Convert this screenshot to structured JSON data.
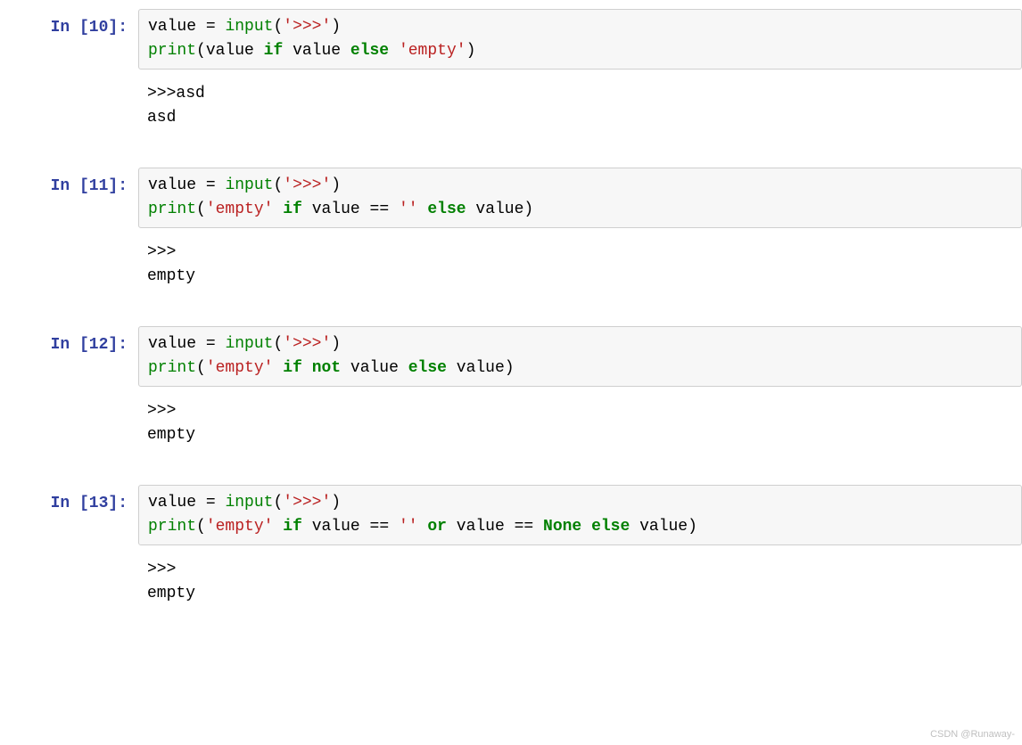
{
  "cells": [
    {
      "prompt": "In [10]:",
      "code_tokens": [
        {
          "t": "value",
          "c": "tok-name"
        },
        {
          "t": " ",
          "c": "tok-punc"
        },
        {
          "t": "=",
          "c": "tok-op"
        },
        {
          "t": " ",
          "c": "tok-punc"
        },
        {
          "t": "input",
          "c": "tok-builtin"
        },
        {
          "t": "(",
          "c": "tok-punc"
        },
        {
          "t": "'>>>'",
          "c": "tok-string"
        },
        {
          "t": ")",
          "c": "tok-punc"
        },
        {
          "t": "\n",
          "c": "tok-punc"
        },
        {
          "t": "print",
          "c": "tok-builtin"
        },
        {
          "t": "(",
          "c": "tok-punc"
        },
        {
          "t": "value",
          "c": "tok-name"
        },
        {
          "t": " ",
          "c": "tok-punc"
        },
        {
          "t": "if",
          "c": "tok-keyword"
        },
        {
          "t": " ",
          "c": "tok-punc"
        },
        {
          "t": "value",
          "c": "tok-name"
        },
        {
          "t": " ",
          "c": "tok-punc"
        },
        {
          "t": "else",
          "c": "tok-keyword"
        },
        {
          "t": " ",
          "c": "tok-punc"
        },
        {
          "t": "'empty'",
          "c": "tok-string"
        },
        {
          "t": ")",
          "c": "tok-punc"
        }
      ],
      "output": ">>>asd\nasd"
    },
    {
      "prompt": "In [11]:",
      "code_tokens": [
        {
          "t": "value",
          "c": "tok-name"
        },
        {
          "t": " ",
          "c": "tok-punc"
        },
        {
          "t": "=",
          "c": "tok-op"
        },
        {
          "t": " ",
          "c": "tok-punc"
        },
        {
          "t": "input",
          "c": "tok-builtin"
        },
        {
          "t": "(",
          "c": "tok-punc"
        },
        {
          "t": "'>>>'",
          "c": "tok-string"
        },
        {
          "t": ")",
          "c": "tok-punc"
        },
        {
          "t": "\n",
          "c": "tok-punc"
        },
        {
          "t": "print",
          "c": "tok-builtin"
        },
        {
          "t": "(",
          "c": "tok-punc"
        },
        {
          "t": "'empty'",
          "c": "tok-string"
        },
        {
          "t": " ",
          "c": "tok-punc"
        },
        {
          "t": "if",
          "c": "tok-keyword"
        },
        {
          "t": " ",
          "c": "tok-punc"
        },
        {
          "t": "value",
          "c": "tok-name"
        },
        {
          "t": " ",
          "c": "tok-punc"
        },
        {
          "t": "==",
          "c": "tok-op"
        },
        {
          "t": " ",
          "c": "tok-punc"
        },
        {
          "t": "''",
          "c": "tok-string"
        },
        {
          "t": " ",
          "c": "tok-punc"
        },
        {
          "t": "else",
          "c": "tok-keyword"
        },
        {
          "t": " ",
          "c": "tok-punc"
        },
        {
          "t": "value",
          "c": "tok-name"
        },
        {
          "t": ")",
          "c": "tok-punc"
        }
      ],
      "output": ">>>\nempty"
    },
    {
      "prompt": "In [12]:",
      "code_tokens": [
        {
          "t": "value",
          "c": "tok-name"
        },
        {
          "t": " ",
          "c": "tok-punc"
        },
        {
          "t": "=",
          "c": "tok-op"
        },
        {
          "t": " ",
          "c": "tok-punc"
        },
        {
          "t": "input",
          "c": "tok-builtin"
        },
        {
          "t": "(",
          "c": "tok-punc"
        },
        {
          "t": "'>>>'",
          "c": "tok-string"
        },
        {
          "t": ")",
          "c": "tok-punc"
        },
        {
          "t": "\n",
          "c": "tok-punc"
        },
        {
          "t": "print",
          "c": "tok-builtin"
        },
        {
          "t": "(",
          "c": "tok-punc"
        },
        {
          "t": "'empty'",
          "c": "tok-string"
        },
        {
          "t": " ",
          "c": "tok-punc"
        },
        {
          "t": "if",
          "c": "tok-keyword"
        },
        {
          "t": " ",
          "c": "tok-punc"
        },
        {
          "t": "not",
          "c": "tok-keyword"
        },
        {
          "t": " ",
          "c": "tok-punc"
        },
        {
          "t": "value",
          "c": "tok-name"
        },
        {
          "t": " ",
          "c": "tok-punc"
        },
        {
          "t": "else",
          "c": "tok-keyword"
        },
        {
          "t": " ",
          "c": "tok-punc"
        },
        {
          "t": "value",
          "c": "tok-name"
        },
        {
          "t": ")",
          "c": "tok-punc"
        }
      ],
      "output": ">>>\nempty"
    },
    {
      "prompt": "In [13]:",
      "code_tokens": [
        {
          "t": "value",
          "c": "tok-name"
        },
        {
          "t": " ",
          "c": "tok-punc"
        },
        {
          "t": "=",
          "c": "tok-op"
        },
        {
          "t": " ",
          "c": "tok-punc"
        },
        {
          "t": "input",
          "c": "tok-builtin"
        },
        {
          "t": "(",
          "c": "tok-punc"
        },
        {
          "t": "'>>>'",
          "c": "tok-string"
        },
        {
          "t": ")",
          "c": "tok-punc"
        },
        {
          "t": "\n",
          "c": "tok-punc"
        },
        {
          "t": "print",
          "c": "tok-builtin"
        },
        {
          "t": "(",
          "c": "tok-punc"
        },
        {
          "t": "'empty'",
          "c": "tok-string"
        },
        {
          "t": " ",
          "c": "tok-punc"
        },
        {
          "t": "if",
          "c": "tok-keyword"
        },
        {
          "t": " ",
          "c": "tok-punc"
        },
        {
          "t": "value",
          "c": "tok-name"
        },
        {
          "t": " ",
          "c": "tok-punc"
        },
        {
          "t": "==",
          "c": "tok-op"
        },
        {
          "t": " ",
          "c": "tok-punc"
        },
        {
          "t": "''",
          "c": "tok-string"
        },
        {
          "t": " ",
          "c": "tok-punc"
        },
        {
          "t": "or",
          "c": "tok-keyword"
        },
        {
          "t": " ",
          "c": "tok-punc"
        },
        {
          "t": "value",
          "c": "tok-name"
        },
        {
          "t": " ",
          "c": "tok-punc"
        },
        {
          "t": "==",
          "c": "tok-op"
        },
        {
          "t": " ",
          "c": "tok-punc"
        },
        {
          "t": "None",
          "c": "tok-keyword-const"
        },
        {
          "t": " ",
          "c": "tok-punc"
        },
        {
          "t": "else",
          "c": "tok-keyword"
        },
        {
          "t": " ",
          "c": "tok-punc"
        },
        {
          "t": "value",
          "c": "tok-name"
        },
        {
          "t": ")",
          "c": "tok-punc"
        }
      ],
      "output": ">>>\nempty"
    }
  ],
  "watermark": "CSDN @Runaway-"
}
